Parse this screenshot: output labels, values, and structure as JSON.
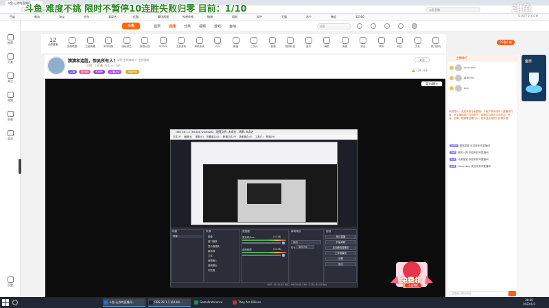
{
  "browser": {
    "tab_title": "斗鱼-让你的直播间...",
    "address": "www.douyu.com/...",
    "search_placeholder": "斗鱼直播",
    "bookmarks": [
      "百度",
      "新浪",
      "淘宝",
      "京东",
      "爱奇艺",
      "优酷",
      "腾讯视频",
      "哔哩哔哩",
      "微博",
      "网易",
      "知乎",
      "天猫",
      "苏宁",
      "携程",
      "12306"
    ]
  },
  "overlay": {
    "title": "斗鱼 难度不挑 限时不暂停10连胜失败归零  目前：1/10",
    "logo": "斗鱼",
    "domain": "DOUYU.COM"
  },
  "sidebar": {
    "items": [
      {
        "label": "推荐",
        "icon": "home-icon"
      },
      {
        "label": "分类",
        "icon": "grid-icon"
      },
      {
        "label": "关注",
        "icon": "heart-icon"
      },
      {
        "label": "视频",
        "icon": "video-icon"
      },
      {
        "label": "鱼吧",
        "icon": "fish-icon"
      },
      {
        "label": "游戏",
        "icon": "gamepad-icon"
      }
    ],
    "settings_label": "设置"
  },
  "site_nav": {
    "logo": "斗鱼",
    "items": [
      "首页",
      "直播",
      "分类",
      "视频",
      "游戏",
      "鱼吧"
    ],
    "active_index": 1,
    "search_placeholder": "搜索"
  },
  "categories": {
    "first": {
      "count": "12",
      "label": "全部直播"
    },
    "items": [
      "英雄联盟",
      "王者荣耀",
      "和平精英",
      "绝地求生",
      "穿越火线",
      "DOTA2",
      "主机游戏",
      "单机游戏",
      "户外",
      "颜值",
      "二次元",
      "一起看",
      "数码科技",
      "音乐",
      "舞蹈",
      "美食",
      "综合",
      "体育",
      "科技",
      "文化",
      "热门游戏",
      "手游",
      "交友",
      "娱乐",
      "电台",
      "更多"
    ],
    "pc_button": "PC客户端"
  },
  "room": {
    "title": "猜猜和连胜，惊吴所有人！",
    "meta": "斗鱼  主机游戏 > 主机游戏",
    "sub": "主播：1级  🔥 关注  🗐 订阅",
    "badges": [
      {
        "label": "主播",
        "color": "#7b5cf0"
      },
      {
        "label": "粉丝团",
        "color": "#f25c9c"
      },
      {
        "label": "签到榜",
        "color": "#9a45e0"
      },
      {
        "label": "主播认证",
        "color": "#b44ef0"
      },
      {
        "label": "超级粉丝",
        "color": "#e9a11d"
      }
    ],
    "follow_label": "关注",
    "stats": "🔔  订阅  分享"
  },
  "player": {
    "quality_btn": "蓝光8M ▾"
  },
  "obs": {
    "title": "OBS 28.1.1 (64-bit, windows) - 配置文件: 未命名 - 场景: 未命名",
    "menu": [
      "文件(F)",
      "编辑(E)",
      "视图(V)",
      "停靠窗口(D)",
      "配置文件(P)",
      "场景集合(S)",
      "工具(T)",
      "帮助(H)"
    ],
    "docks": {
      "scenes": "场景",
      "sources": "来源",
      "mixer": "混音器",
      "transitions": "转场特效",
      "controls": "控制"
    },
    "scene_list": [
      "场景"
    ],
    "sources": [
      "图像",
      "窗口捕获",
      "显示器捕获",
      "媒体源",
      "文本",
      "音频输入",
      "音频输出",
      "浏览器"
    ],
    "mixer_tracks": [
      {
        "name": "麦克风/Aux",
        "level": "0.0 dB"
      },
      {
        "name": "桌面音频",
        "level": "0.0 dB"
      }
    ],
    "transition": {
      "name": "淡出",
      "duration_label": "时长",
      "duration": "300 ms"
    },
    "controls": [
      "停止直播",
      "开始录制",
      "启动虚拟摄像机",
      "工作室模式",
      "设置",
      "退出"
    ],
    "status": "LIVE: 01:12:43   REC: 00:00:00   CPU: 3.2%, 60.00 fps"
  },
  "gift": {
    "label": "免费领",
    "badge": "点击领取"
  },
  "chat": {
    "header": "主播排行",
    "ranks": [
      {
        "user": "lovenhw0"
      },
      {
        "user": "星咪乐咪"
      },
      {
        "user": "Jaze"
      }
    ],
    "notice": "系统提示：欢迎来到斗鱼直播！斗鱼严禁未成年人直播或打赏，请主播和用户自觉遵守。直播内容禁止涉及政治、低俗、色情、赌博等违规行为，如有违反将进行封禁处理。",
    "lines": [
      {
        "tag": "Lv10",
        "text": "酷炫星星  欢迎来到本直播间"
      },
      {
        "tag": "Lv6",
        "text": "微风一阵  欢迎来到本直播间"
      },
      {
        "tag": "Lv3",
        "text": "大鹅宝宝  欢迎来到本直播间"
      },
      {
        "tag": "Lv2",
        "text": "douyuboy  欢迎来到本直播间"
      }
    ],
    "input_placeholder": "这里输入聊天内容"
  },
  "rail": {
    "label": "鱼乐"
  },
  "taskbar": {
    "apps": [
      {
        "label": "斗鱼-让你的直播间...",
        "color": "#2b6dd6",
        "active": true
      },
      {
        "label": "OBS 28.1.1 (64-bit...",
        "color": "#222",
        "active": true
      },
      {
        "label": "GamePreference",
        "color": "#1d8f5a",
        "active": false
      },
      {
        "label": "They Are Billions",
        "color": "#b73a2a",
        "active": false
      }
    ],
    "time": "20:30",
    "date": "2022/1/2"
  }
}
